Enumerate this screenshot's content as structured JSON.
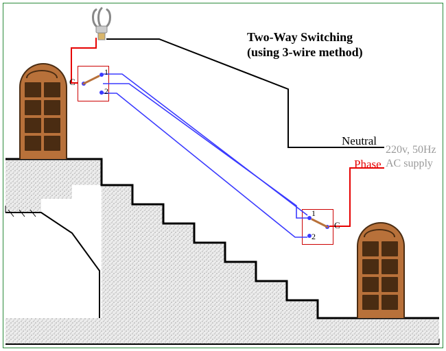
{
  "title": {
    "line1": "Two-Way Switching",
    "line2": "(using 3-wire method)"
  },
  "labels": {
    "neutral": "Neutral",
    "phase": "Phase",
    "supply1": "220v, 50Hz",
    "supply2": "AC supply"
  },
  "switch1": {
    "C": "C",
    "t1": "1",
    "t2": "2"
  },
  "switch2": {
    "C": "C",
    "t1": "1",
    "t2": "2"
  },
  "colors": {
    "neutral": "#000000",
    "phase": "#e60000",
    "traveller": "#3a3aff",
    "frame": "#2a8a3a",
    "concrete": "#cfcfcf",
    "wood": "#b8713a"
  },
  "physical": {
    "description": "CFL bulb at top of stairs controlled by two SPDT switches (3-wire method). Stairs with concrete texture, wooden doors at top and bottom.",
    "stairs_steps": 8,
    "supply": {
      "voltage_V": 220,
      "frequency_Hz": 50,
      "type": "AC"
    }
  }
}
